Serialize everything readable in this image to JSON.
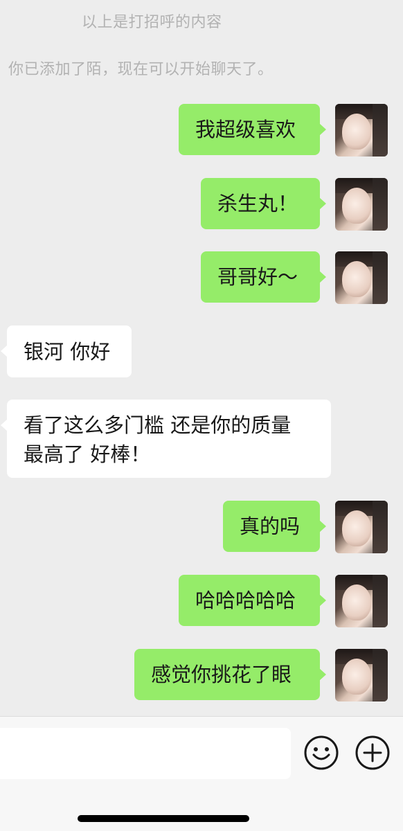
{
  "system": {
    "greeting_note": "以上是打招呼的内容",
    "added_note": "你已添加了陌，现在可以开始聊天了。"
  },
  "messages": [
    {
      "from": "me",
      "text": "我超级喜欢"
    },
    {
      "from": "me",
      "text": "杀生丸！"
    },
    {
      "from": "me",
      "text": "哥哥好～"
    },
    {
      "from": "them",
      "text": "银河 你好"
    },
    {
      "from": "them",
      "line1": "看了这么多门槛 还是你的质量",
      "line2": "最高了 好棒！"
    },
    {
      "from": "me",
      "text": "真的吗"
    },
    {
      "from": "me",
      "text": "哈哈哈哈哈"
    },
    {
      "from": "me",
      "text": "感觉你挑花了眼"
    }
  ],
  "input": {
    "value": "",
    "emoji_icon": "smiley-face-icon",
    "more_icon": "plus-circle-icon"
  },
  "colors": {
    "background": "#ededed",
    "my_bubble": "#95ec69",
    "their_bubble": "#ffffff",
    "system_text": "#b2b2b2"
  }
}
